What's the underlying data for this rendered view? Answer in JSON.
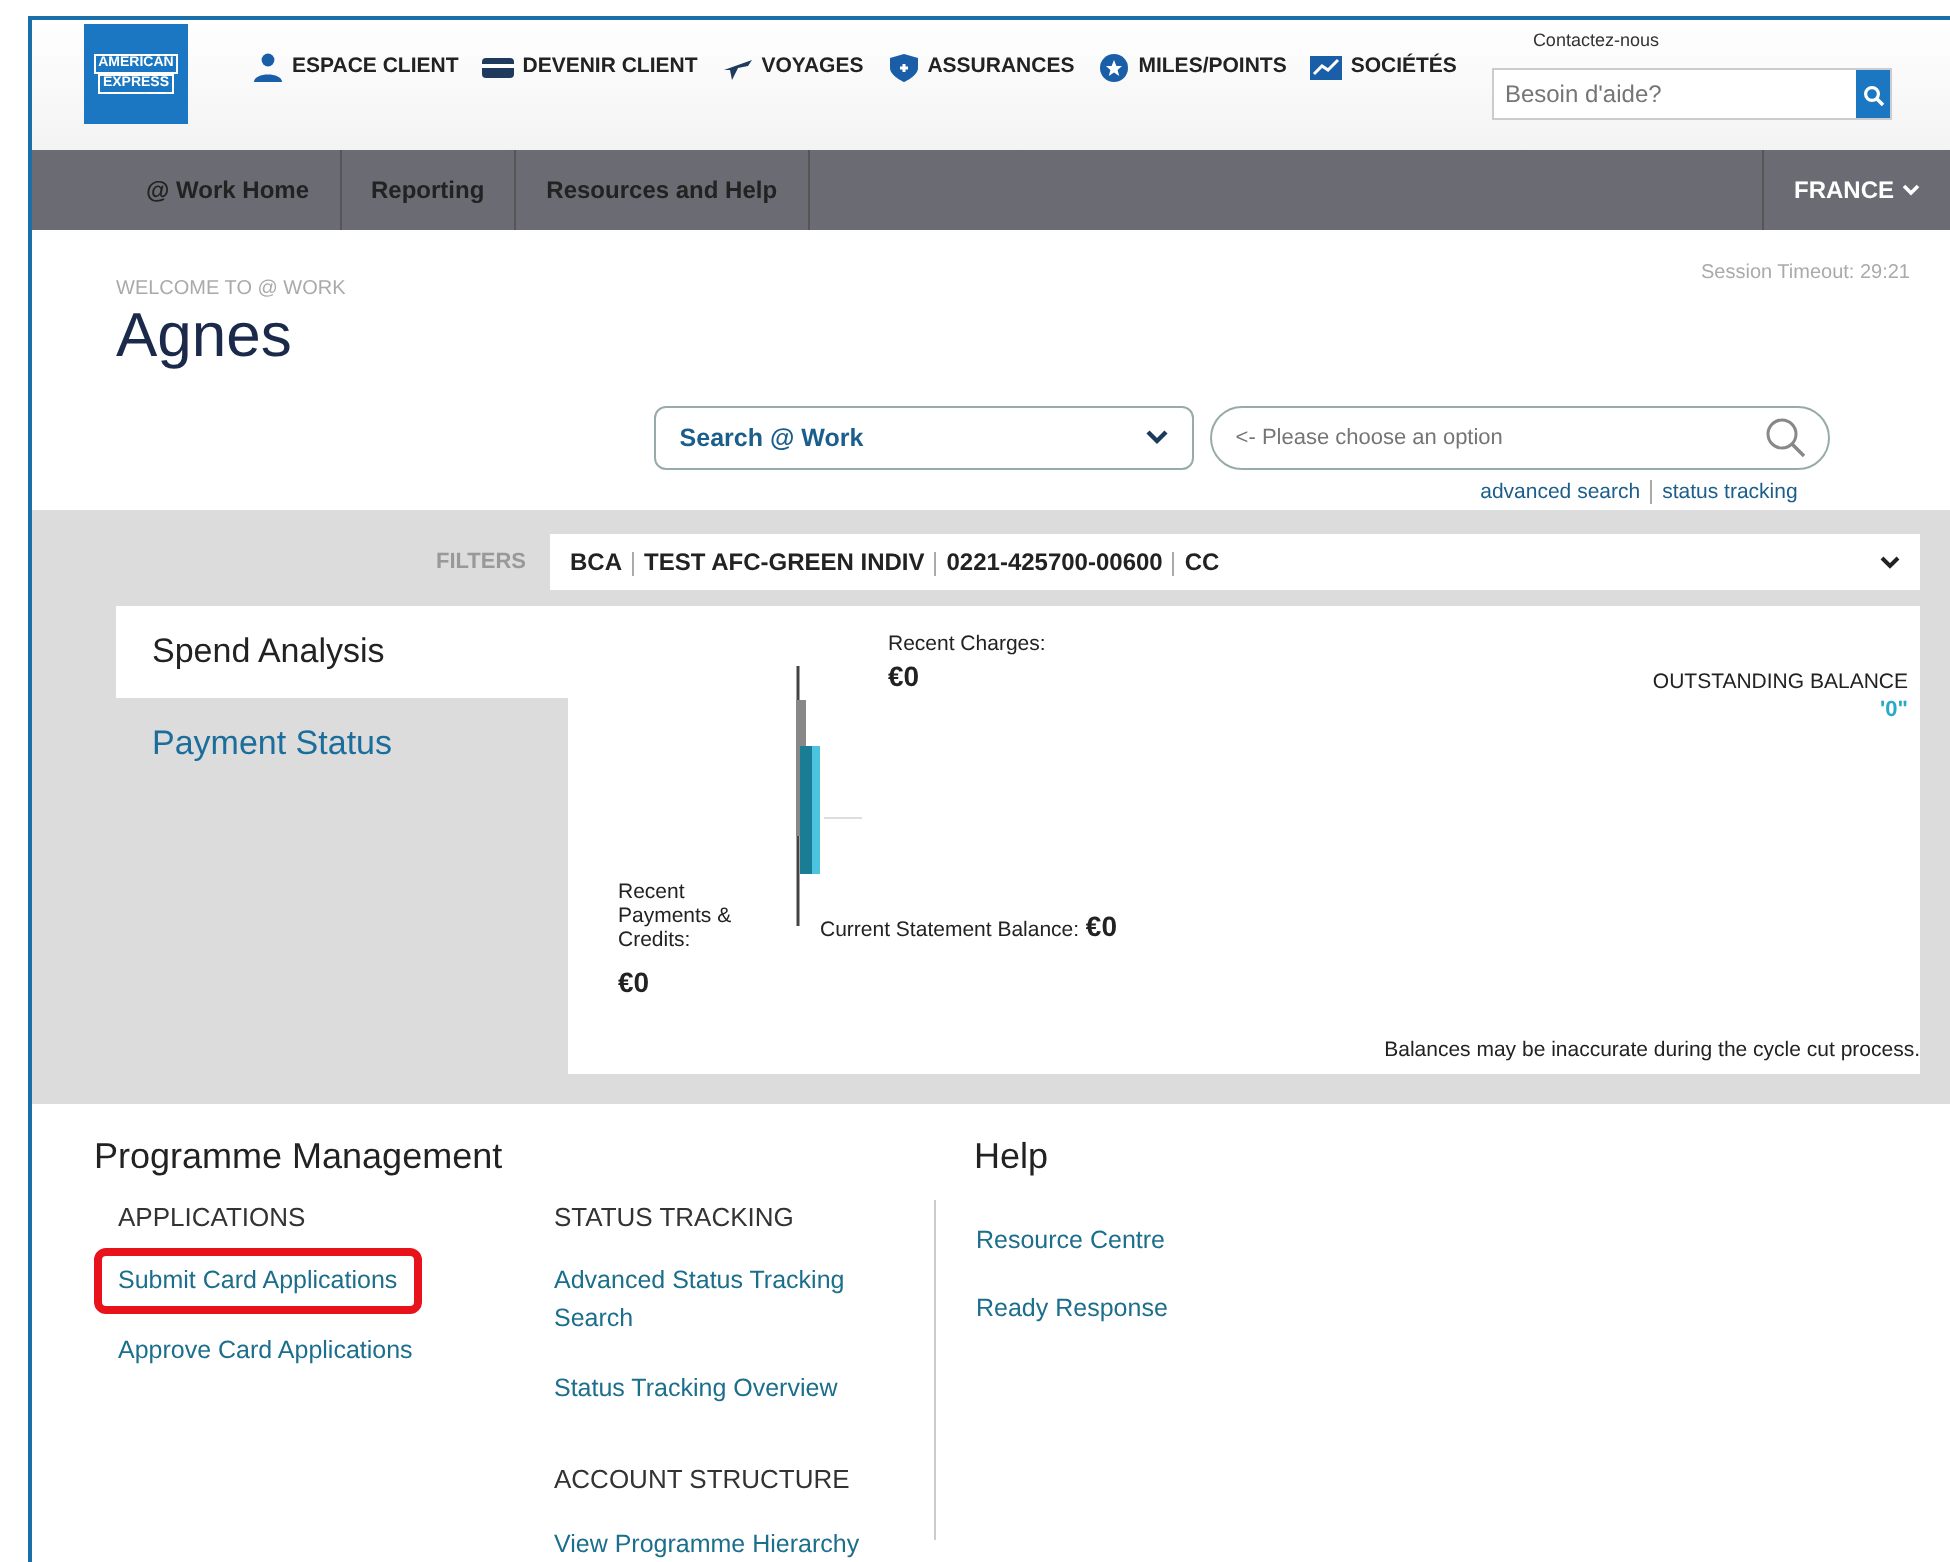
{
  "logo": {
    "line1": "AMERICAN",
    "line2": "EXPRESS"
  },
  "top_nav": [
    {
      "label": "ESPACE CLIENT"
    },
    {
      "label": "DEVENIR CLIENT"
    },
    {
      "label": "VOYAGES"
    },
    {
      "label": "ASSURANCES"
    },
    {
      "label": "MILES/POINTS"
    },
    {
      "label": "SOCIÉTÉS"
    }
  ],
  "contact": "Contactez-nous",
  "help_search": {
    "placeholder": "Besoin d'aide?"
  },
  "menu": [
    {
      "label": "@ Work Home",
      "selected": false
    },
    {
      "label": "Reporting",
      "selected": false
    },
    {
      "label": "Resources and Help",
      "selected": false
    }
  ],
  "country": "FRANCE",
  "session_timeout": "Session Timeout: 29:21",
  "welcome": "WELCOME TO @ WORK",
  "user_name": "Agnes",
  "search": {
    "scope": "Search @ Work",
    "placeholder": "<- Please choose an option",
    "links": [
      "advanced search",
      "status tracking"
    ]
  },
  "filters": {
    "label": "FILTERS",
    "values": [
      "BCA",
      "TEST AFC-GREEN INDIV",
      "0221-425700-00600",
      "CC"
    ]
  },
  "side_tabs": [
    {
      "label": "Spend Analysis",
      "selected": true
    },
    {
      "label": "Payment Status",
      "selected": false
    }
  ],
  "spend": {
    "recent_charges_label": "Recent Charges:",
    "recent_charges": "€0",
    "payments_label": "Recent Payments & Credits:",
    "payments": "€0",
    "statement_label": "Current Statement Balance:",
    "statement": "€0",
    "outstanding_label": "OUTSTANDING BALANCE",
    "outstanding": "'0\"",
    "note": "Balances may be inaccurate during the cycle cut process."
  },
  "programme": {
    "title": "Programme Management",
    "groups": [
      {
        "heading": "APPLICATIONS",
        "links": [
          {
            "label": "Submit Card Applications",
            "highlighted": true
          },
          {
            "label": "Approve Card Applications",
            "highlighted": false
          }
        ]
      },
      {
        "heading": "STATUS TRACKING",
        "links": [
          {
            "label": "Advanced Status Tracking Search",
            "highlighted": false
          },
          {
            "label": "Status Tracking Overview",
            "highlighted": false
          }
        ]
      },
      {
        "heading": "ACCOUNT STRUCTURE",
        "links": [
          {
            "label": "View Programme Hierarchy",
            "highlighted": false
          }
        ]
      }
    ]
  },
  "help": {
    "title": "Help",
    "links": [
      {
        "label": "Resource Centre"
      },
      {
        "label": "Ready Response"
      }
    ]
  }
}
